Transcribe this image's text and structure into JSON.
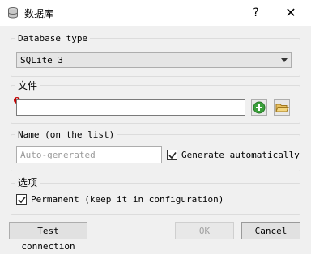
{
  "window": {
    "title": "数据库",
    "help_label": "?",
    "close_label": "✕"
  },
  "database_type": {
    "group_label": "Database type",
    "selected": "SQLite 3"
  },
  "file": {
    "group_label": "文件",
    "value": "",
    "required_marker": "!"
  },
  "name": {
    "group_label": "Name (on the list)",
    "placeholder": "Auto-generated",
    "auto_label": "Generate automatically",
    "auto_checked": true
  },
  "options": {
    "group_label": "选项",
    "permanent_label": "Permanent (keep it in configuration)",
    "permanent_checked": true
  },
  "buttons": {
    "test": "Test connection",
    "ok": "OK",
    "cancel": "Cancel"
  },
  "colors": {
    "add_green": "#3aa03a",
    "folder_yellow": "#e8c060"
  },
  "icons": [
    "database-icon",
    "add-icon",
    "folder-open-icon",
    "help-icon",
    "close-icon"
  ]
}
